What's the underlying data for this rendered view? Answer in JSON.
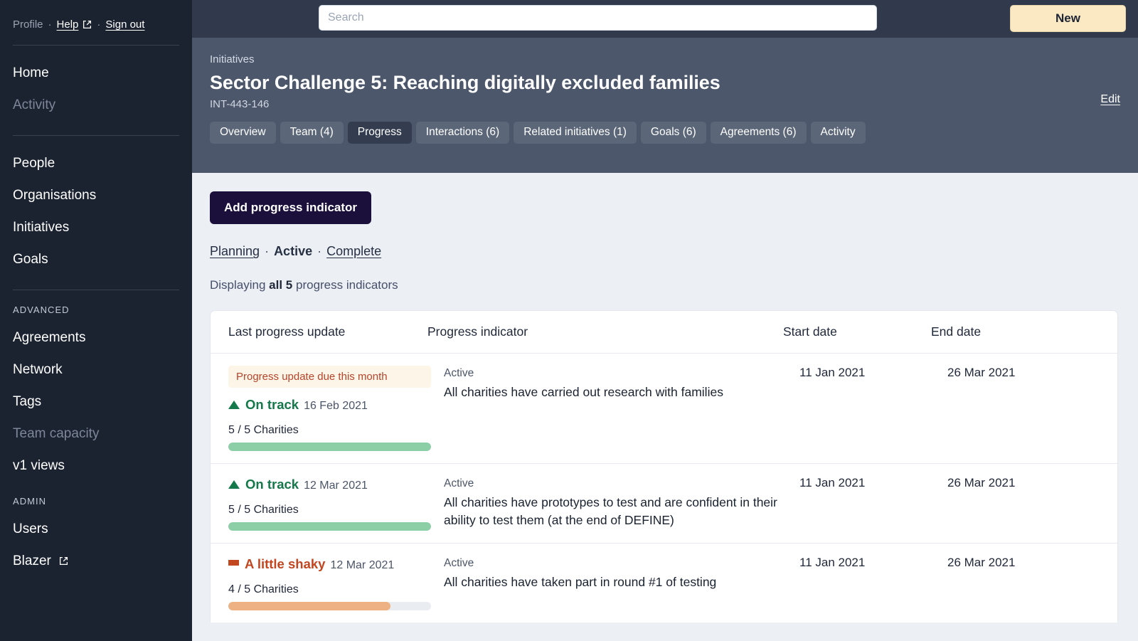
{
  "sidebar": {
    "account": {
      "profile": "Profile",
      "help": "Help",
      "sign_out": "Sign out",
      "separator": "·"
    },
    "primary": [
      {
        "label": "Home",
        "muted": false
      },
      {
        "label": "Activity",
        "muted": true
      }
    ],
    "secondary": [
      {
        "label": "People",
        "muted": false
      },
      {
        "label": "Organisations",
        "muted": false
      },
      {
        "label": "Initiatives",
        "muted": false
      },
      {
        "label": "Goals",
        "muted": false
      }
    ],
    "advanced_heading": "ADVANCED",
    "advanced": [
      {
        "label": "Agreements",
        "muted": false,
        "external": false
      },
      {
        "label": "Network",
        "muted": false,
        "external": false
      },
      {
        "label": "Tags",
        "muted": false,
        "external": false
      },
      {
        "label": "Team capacity",
        "muted": true,
        "external": false
      },
      {
        "label": "v1 views",
        "muted": false,
        "external": false
      }
    ],
    "admin_heading": "ADMIN",
    "admin": [
      {
        "label": "Users",
        "muted": false,
        "external": false
      },
      {
        "label": "Blazer",
        "muted": false,
        "external": true
      }
    ]
  },
  "topbar": {
    "search_placeholder": "Search",
    "search_value": "",
    "new_label": "New"
  },
  "pagehead": {
    "breadcrumb": "Initiatives",
    "title": "Sector Challenge 5: Reaching digitally excluded families",
    "reference": "INT-443-146",
    "edit_label": "Edit",
    "tabs": [
      {
        "label": "Overview",
        "active": false
      },
      {
        "label": "Team (4)",
        "active": false
      },
      {
        "label": "Progress",
        "active": true
      },
      {
        "label": "Interactions (6)",
        "active": false
      },
      {
        "label": "Related initiatives (1)",
        "active": false
      },
      {
        "label": "Goals (6)",
        "active": false
      },
      {
        "label": "Agreements (6)",
        "active": false
      },
      {
        "label": "Activity",
        "active": false
      }
    ]
  },
  "content": {
    "add_button": "Add progress indicator",
    "filters": {
      "planning": "Planning",
      "active": "Active",
      "complete": "Complete",
      "separator": "·"
    },
    "displaying": {
      "prefix": "Displaying",
      "count": "all 5",
      "suffix": "progress indicators"
    },
    "table": {
      "headers": {
        "last_update": "Last progress update",
        "indicator": "Progress indicator",
        "start_date": "Start date",
        "end_date": "End date"
      },
      "rows": [
        {
          "due_badge": "Progress update due this month",
          "status": "On track",
          "status_type": "ontrack",
          "status_date": "16 Feb 2021",
          "fraction": "5 / 5 Charities",
          "progress_percent": 100,
          "indicator_state": "Active",
          "indicator_text": "All charities have carried out research with families",
          "start_date": "11 Jan 2021",
          "end_date": "26 Mar 2021"
        },
        {
          "due_badge": "",
          "status": "On track",
          "status_type": "ontrack",
          "status_date": "12 Mar 2021",
          "fraction": "5 / 5 Charities",
          "progress_percent": 100,
          "indicator_state": "Active",
          "indicator_text": "All charities have prototypes to test and are confident in their ability to test them (at the end of DEFINE)",
          "start_date": "11 Jan 2021",
          "end_date": "26 Mar 2021"
        },
        {
          "due_badge": "",
          "status": "A little shaky",
          "status_type": "shaky",
          "status_date": "12 Mar 2021",
          "fraction": "4 / 5 Charities",
          "progress_percent": 80,
          "indicator_state": "Active",
          "indicator_text": "All charities have taken part in round #1 of testing",
          "start_date": "11 Jan 2021",
          "end_date": "26 Mar 2021"
        }
      ]
    }
  },
  "colors": {
    "sidebar_bg": "#1b2230",
    "topbar_bg": "#313a4c",
    "pagehead_bg": "#4c576b",
    "content_bg": "#eceff4",
    "accent_new": "#fbe9c4",
    "accent_add": "#1b0f3b",
    "ontrack": "#15784a",
    "shaky": "#c2461f",
    "bar_green": "#8ccfa6",
    "bar_orange": "#edb183",
    "badge_bg": "#fdf5e7"
  }
}
